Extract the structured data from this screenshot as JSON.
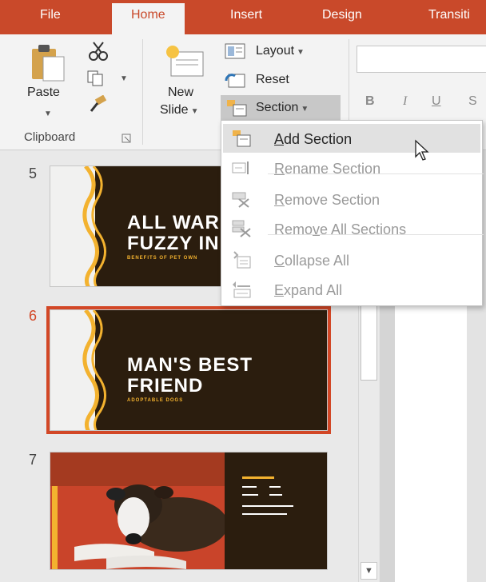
{
  "tabs": [
    {
      "label": "File"
    },
    {
      "label": "Home"
    },
    {
      "label": "Insert"
    },
    {
      "label": "Design"
    },
    {
      "label": "Transiti"
    }
  ],
  "clipboard": {
    "paste_label": "Paste",
    "group_label": "Clipboard"
  },
  "slides_group": {
    "new_slide_line1": "New",
    "new_slide_line2": "Slide",
    "layout_label": "Layout",
    "reset_label": "Reset",
    "section_label": "Section"
  },
  "font_group": {
    "bold": "B",
    "italic": "I",
    "underline": "U",
    "strike": "S"
  },
  "section_menu": {
    "items": [
      {
        "pre": "",
        "key": "A",
        "post": "dd Section",
        "icon": "add-section-icon",
        "enabled": true
      },
      {
        "pre": "",
        "key": "R",
        "post": "ename Section",
        "icon": "rename-section-icon",
        "enabled": false
      },
      {
        "pre": "",
        "key": "R",
        "post": "emove Section",
        "icon": "remove-section-icon",
        "enabled": false
      },
      {
        "pre": "Remo",
        "key": "v",
        "post": "e All Sections",
        "icon": "remove-all-sections-icon",
        "enabled": false
      },
      {
        "pre": "",
        "key": "C",
        "post": "ollapse All",
        "icon": "collapse-all-icon",
        "enabled": false
      },
      {
        "pre": "",
        "key": "E",
        "post": "xpand All",
        "icon": "expand-all-icon",
        "enabled": false
      }
    ]
  },
  "slides": [
    {
      "number": "5",
      "title_line1": "ALL WAR",
      "title_line2": "FUZZY IN",
      "subtitle": "BENEFITS OF PET OWN"
    },
    {
      "number": "6",
      "title_line1": "MAN'S BEST",
      "title_line2": "FRIEND",
      "subtitle": "ADOPTABLE DOGS"
    },
    {
      "number": "7"
    }
  ],
  "colors": {
    "accent": "#c9492a",
    "selection": "#d24726",
    "slide_dark": "#2b1d0e",
    "slide_yellow": "#f3b22f"
  }
}
